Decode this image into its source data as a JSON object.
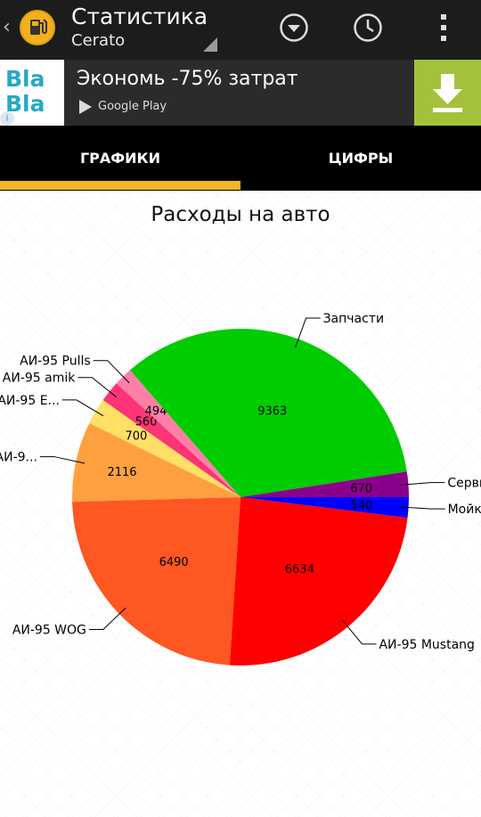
{
  "appbar": {
    "back_glyph": "‹",
    "logo_icon": "fuel-pump-icon",
    "title": "Статистика",
    "subtitle": "Cerato",
    "icons": [
      "dropdown-circle-icon",
      "clock-icon",
      "overflow-menu-icon"
    ]
  },
  "ad": {
    "logo_line1": "Bla",
    "logo_line2": "Bla",
    "info_glyph": "i",
    "text": "Экономь -75% затрат",
    "store_label": "Google Play",
    "download_icon": "download-icon",
    "colors": {
      "download_bg": "#a3c23b",
      "logo_blue": "#2aa8c4",
      "logo_green": "#79b829"
    }
  },
  "tabs": [
    {
      "label": "ГРАФИКИ",
      "active": true
    },
    {
      "label": "ЦИФРЫ",
      "active": false
    }
  ],
  "accent_color": "#f3b52b",
  "chart_data": {
    "type": "pie",
    "title": "Расходы на авто",
    "slices": [
      {
        "label": "Мойка",
        "value": 540,
        "color": "#0000ff"
      },
      {
        "label": "АИ-95 Mustang",
        "value": 6634,
        "color": "#ff0000"
      },
      {
        "label": "АИ-95 WOG",
        "value": 6490,
        "color": "#ff5722"
      },
      {
        "label": "АИ-9...",
        "value": 2116,
        "color": "#ffa040"
      },
      {
        "label": "АИ-95 Е...",
        "value": 700,
        "color": "#ffe066"
      },
      {
        "label": "АИ-95 amik",
        "value": 560,
        "color": "#ff3377"
      },
      {
        "label": "АИ-95 Pulls",
        "value": 494,
        "color": "#ff7fa6"
      },
      {
        "label": "Запчасти",
        "value": 9363,
        "color": "#00cc00"
      },
      {
        "label": "Сервис",
        "value": 670,
        "color": "#8b008b"
      }
    ]
  }
}
